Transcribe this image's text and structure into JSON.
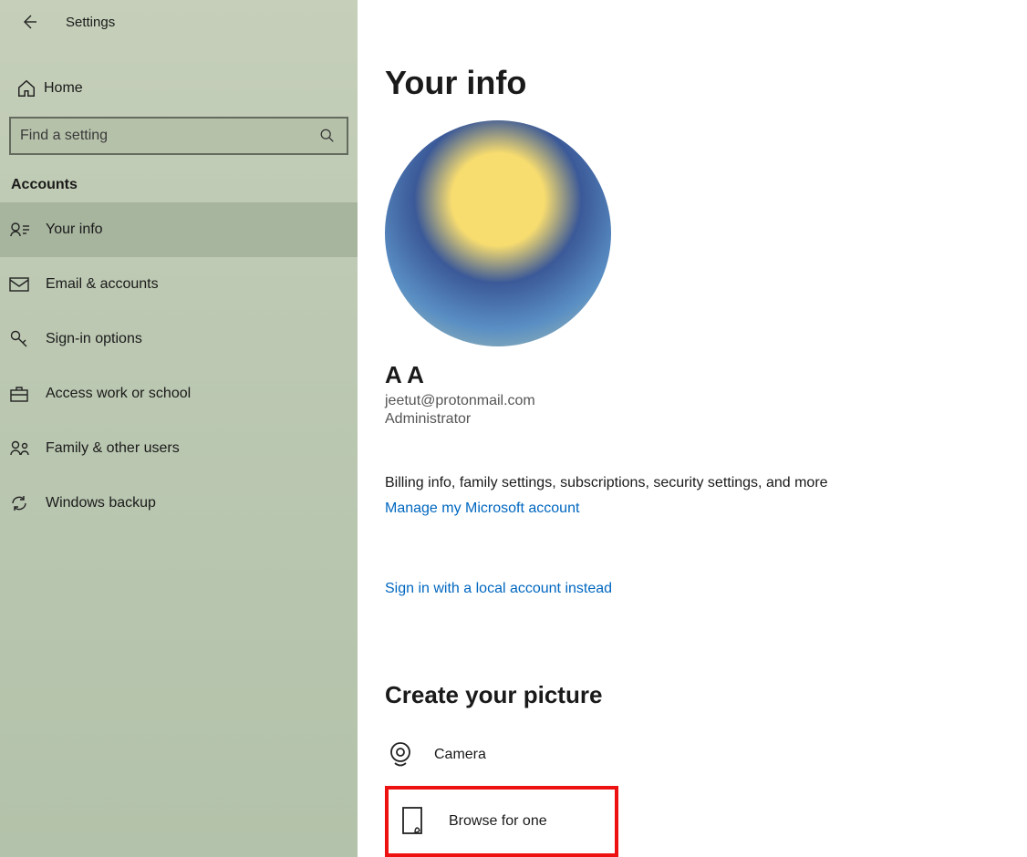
{
  "header": {
    "title": "Settings"
  },
  "sidebar": {
    "home_label": "Home",
    "search_placeholder": "Find a setting",
    "section_label": "Accounts",
    "items": [
      {
        "label": "Your info"
      },
      {
        "label": "Email & accounts"
      },
      {
        "label": "Sign-in options"
      },
      {
        "label": "Access work or school"
      },
      {
        "label": "Family & other users"
      },
      {
        "label": "Windows backup"
      }
    ]
  },
  "main": {
    "page_title": "Your info",
    "user_name": "A A",
    "user_email": "jeetut@protonmail.com",
    "user_role": "Administrator",
    "billing_text": "Billing info, family settings, subscriptions, security settings, and more",
    "manage_link": "Manage my Microsoft account",
    "local_link": "Sign in with a local account instead",
    "create_picture_heading": "Create your picture",
    "camera_label": "Camera",
    "browse_label": "Browse for one"
  }
}
